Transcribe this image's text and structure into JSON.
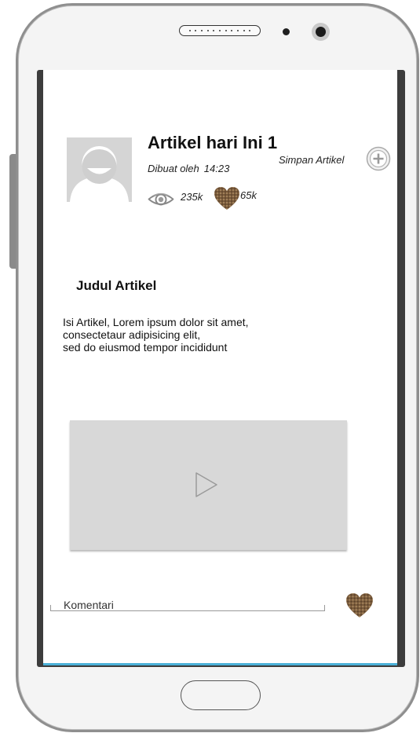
{
  "article": {
    "title": "Artikel hari Ini 1",
    "author_label": "Dibuat oleh",
    "time": "14:23",
    "views": "235k",
    "likes": "65k",
    "heading": "Judul Artikel",
    "body_lines": [
      "Isi Artikel, Lorem ipsum dolor sit amet,",
      "consectetaur adipisicing elit,",
      "sed do eiusmod tempor incididunt"
    ]
  },
  "actions": {
    "save_label": "Simpan Artikel"
  },
  "comment": {
    "placeholder": "Komentari"
  },
  "icons": {
    "avatar": "avatar-placeholder-icon",
    "views": "eye-icon",
    "likes": "heart-icon",
    "save": "plus-circle-icon",
    "video": "play-icon"
  },
  "colors": {
    "accent_line": "#4bb1d8",
    "heart": "#8a6a4a",
    "placeholder_gray": "#d8d8d8"
  }
}
